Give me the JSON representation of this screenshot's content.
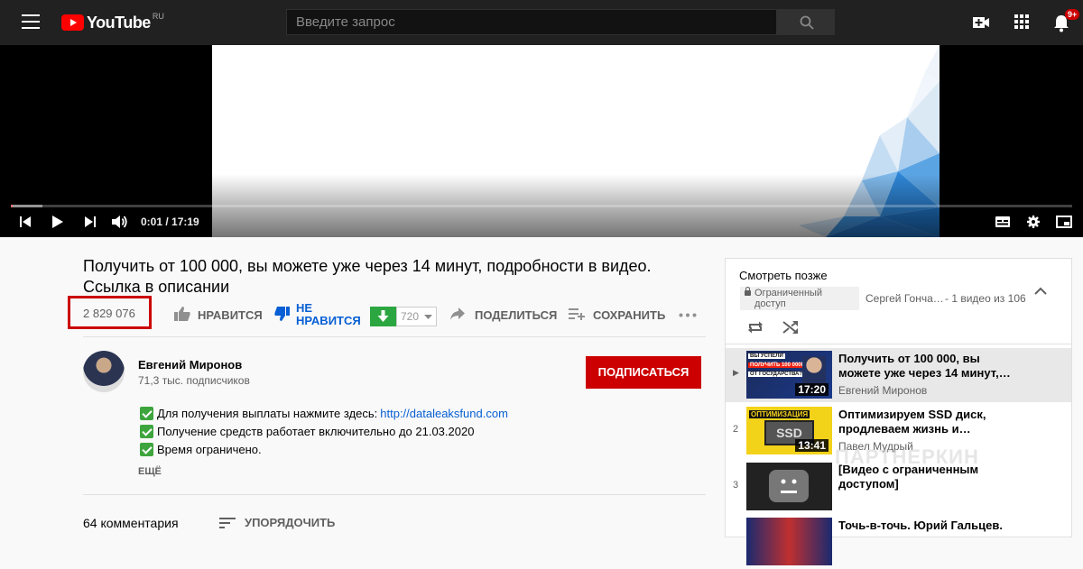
{
  "header": {
    "logo_text": "YouTube",
    "logo_region": "RU",
    "search_placeholder": "Введите запрос",
    "notifications_badge": "9+"
  },
  "player": {
    "time": "0:01 / 17:19",
    "progress_fraction": 0.0015,
    "buffered_fraction": 0.03
  },
  "video": {
    "title": "Получить от 100 000, вы можете уже через 14 минут, подробности в видео. Ссылка в описании",
    "views": "2 829 076",
    "like_label": "НРАВИТСЯ",
    "dislike_label_1": "НЕ",
    "dislike_label_2": "НРАВИТСЯ",
    "download_quality": "720",
    "share_label": "ПОДЕЛИТЬСЯ",
    "save_label": "СОХРАНИТЬ"
  },
  "channel": {
    "name": "Евгений Миронов",
    "subscribers": "71,3 тыс. подписчиков",
    "subscribe_label": "ПОДПИСАТЬСЯ"
  },
  "description": {
    "line1": "Для получения выплаты нажмите здесь:",
    "line1_link": "http://dataleaksfund.com",
    "line2": "Получение средств работает включительно до 21.03.2020",
    "line3": "Время ограничено.",
    "more_label": "ЕЩЁ"
  },
  "comments": {
    "count_label": "64 комментария",
    "sort_label": "УПОРЯДОЧИТЬ"
  },
  "playlist": {
    "title": "Смотреть позже",
    "restricted_line1": "Ограниченный",
    "restricted_line2": "доступ",
    "owner": "Сергей Гонча…",
    "count": "- 1 видео из 106",
    "items": [
      {
        "index": "▶",
        "title": "Получить от 100 000, вы можете уже через 14 минут,…",
        "channel": "Евгений Миронов",
        "duration": "17:20",
        "thumb_text1": "ВЫ УСПЕЛИ",
        "thumb_text2": "ПОЛУЧИТЬ 100 000Р",
        "thumb_text3": "ОТ ГОСУДАРСТВА?"
      },
      {
        "index": "2",
        "title": "Оптимизируем SSD диск, продлеваем жизнь и…",
        "channel": "Павел Мудрый",
        "duration": "13:41",
        "thumb_text1": "ОПТИМИЗАЦИЯ",
        "thumb_text2": "SSD"
      },
      {
        "index": "3",
        "title": "[Видео с ограниченным доступом]",
        "channel": ""
      },
      {
        "index": "",
        "title": "Точь-в-точь. Юрий Гальцев.",
        "channel": ""
      }
    ]
  },
  "watermark": "ПАРТНЕРКИН",
  "colors": {
    "accent_red": "#cc0000",
    "link_blue": "#065fd4",
    "download_green": "#2ba640"
  }
}
